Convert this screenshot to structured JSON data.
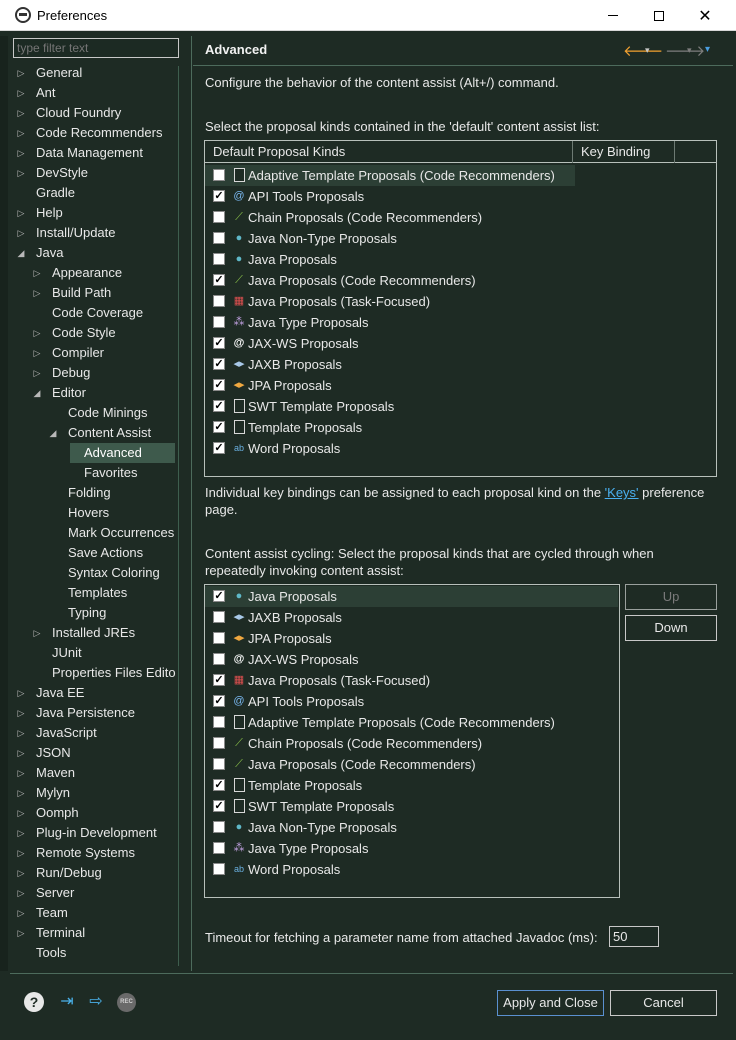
{
  "window": {
    "title": "Preferences",
    "minimize": "—",
    "maximize": "☐",
    "close": "✕"
  },
  "filter": {
    "placeholder": "type filter text"
  },
  "tree": [
    {
      "label": "General",
      "depth": 0,
      "arrow": "▷"
    },
    {
      "label": "Ant",
      "depth": 0,
      "arrow": "▷"
    },
    {
      "label": "Cloud Foundry",
      "depth": 0,
      "arrow": "▷"
    },
    {
      "label": "Code Recommenders",
      "depth": 0,
      "arrow": "▷"
    },
    {
      "label": "Data Management",
      "depth": 0,
      "arrow": "▷"
    },
    {
      "label": "DevStyle",
      "depth": 0,
      "arrow": "▷"
    },
    {
      "label": "Gradle",
      "depth": 0,
      "arrow": ""
    },
    {
      "label": "Help",
      "depth": 0,
      "arrow": "▷"
    },
    {
      "label": "Install/Update",
      "depth": 0,
      "arrow": "▷"
    },
    {
      "label": "Java",
      "depth": 0,
      "arrow": "◢"
    },
    {
      "label": "Appearance",
      "depth": 1,
      "arrow": "▷"
    },
    {
      "label": "Build Path",
      "depth": 1,
      "arrow": "▷"
    },
    {
      "label": "Code Coverage",
      "depth": 1,
      "arrow": ""
    },
    {
      "label": "Code Style",
      "depth": 1,
      "arrow": "▷"
    },
    {
      "label": "Compiler",
      "depth": 1,
      "arrow": "▷"
    },
    {
      "label": "Debug",
      "depth": 1,
      "arrow": "▷"
    },
    {
      "label": "Editor",
      "depth": 1,
      "arrow": "◢"
    },
    {
      "label": "Code Minings",
      "depth": 2,
      "arrow": ""
    },
    {
      "label": "Content Assist",
      "depth": 2,
      "arrow": "◢"
    },
    {
      "label": "Advanced",
      "depth": 3,
      "arrow": "",
      "selected": true
    },
    {
      "label": "Favorites",
      "depth": 3,
      "arrow": ""
    },
    {
      "label": "Folding",
      "depth": 2,
      "arrow": ""
    },
    {
      "label": "Hovers",
      "depth": 2,
      "arrow": ""
    },
    {
      "label": "Mark Occurrences",
      "depth": 2,
      "arrow": ""
    },
    {
      "label": "Save Actions",
      "depth": 2,
      "arrow": ""
    },
    {
      "label": "Syntax Coloring",
      "depth": 2,
      "arrow": ""
    },
    {
      "label": "Templates",
      "depth": 2,
      "arrow": ""
    },
    {
      "label": "Typing",
      "depth": 2,
      "arrow": ""
    },
    {
      "label": "Installed JREs",
      "depth": 1,
      "arrow": "▷"
    },
    {
      "label": "JUnit",
      "depth": 1,
      "arrow": ""
    },
    {
      "label": "Properties Files Edito",
      "depth": 1,
      "arrow": ""
    },
    {
      "label": "Java EE",
      "depth": 0,
      "arrow": "▷"
    },
    {
      "label": "Java Persistence",
      "depth": 0,
      "arrow": "▷"
    },
    {
      "label": "JavaScript",
      "depth": 0,
      "arrow": "▷"
    },
    {
      "label": "JSON",
      "depth": 0,
      "arrow": "▷"
    },
    {
      "label": "Maven",
      "depth": 0,
      "arrow": "▷"
    },
    {
      "label": "Mylyn",
      "depth": 0,
      "arrow": "▷"
    },
    {
      "label": "Oomph",
      "depth": 0,
      "arrow": "▷"
    },
    {
      "label": "Plug-in Development",
      "depth": 0,
      "arrow": "▷"
    },
    {
      "label": "Remote Systems",
      "depth": 0,
      "arrow": "▷"
    },
    {
      "label": "Run/Debug",
      "depth": 0,
      "arrow": "▷"
    },
    {
      "label": "Server",
      "depth": 0,
      "arrow": "▷"
    },
    {
      "label": "Team",
      "depth": 0,
      "arrow": "▷"
    },
    {
      "label": "Terminal",
      "depth": 0,
      "arrow": "▷"
    },
    {
      "label": "Tools",
      "depth": 0,
      "arrow": ""
    }
  ],
  "page": {
    "title": "Advanced",
    "nav": {
      "back": "🡐",
      "dropdown": "▾",
      "forward": "🡒",
      "menu": "▾"
    },
    "description": "Configure the behavior of the content assist (Alt+/) command.",
    "default_list_label": "Select the proposal kinds contained in the 'default' content assist list:",
    "default_table": {
      "col_kinds": "Default Proposal Kinds",
      "col_binding": "Key Binding",
      "rows": [
        {
          "checked": false,
          "icon": "doc",
          "name": "Adaptive Template Proposals (Code Recommenders)"
        },
        {
          "checked": true,
          "icon": "blue",
          "name": "API Tools Proposals"
        },
        {
          "checked": false,
          "icon": "green",
          "name": "Chain Proposals (Code Recommenders)"
        },
        {
          "checked": false,
          "icon": "java",
          "name": "Java Non-Type Proposals"
        },
        {
          "checked": false,
          "icon": "java",
          "name": "Java Proposals"
        },
        {
          "checked": true,
          "icon": "green",
          "name": "Java Proposals (Code Recommenders)"
        },
        {
          "checked": false,
          "icon": "task",
          "name": "Java Proposals (Task-Focused)"
        },
        {
          "checked": false,
          "icon": "type",
          "name": "Java Type Proposals"
        },
        {
          "checked": true,
          "icon": "at",
          "name": "JAX-WS Proposals"
        },
        {
          "checked": true,
          "icon": "jaxb",
          "name": "JAXB Proposals"
        },
        {
          "checked": true,
          "icon": "jpa",
          "name": "JPA Proposals"
        },
        {
          "checked": true,
          "icon": "doc",
          "name": "SWT Template Proposals"
        },
        {
          "checked": true,
          "icon": "doc",
          "name": "Template Proposals"
        },
        {
          "checked": true,
          "icon": "word",
          "name": "Word Proposals"
        }
      ]
    },
    "keybind_note_pre": "Individual key bindings can be assigned to each proposal kind on the ",
    "keybind_link": "'Keys'",
    "keybind_note_post": " preference",
    "keybind_note_line2": "page.",
    "cycling_label_1": "Content assist cycling: Select the proposal kinds that are cycled through when",
    "cycling_label_2": "repeatedly invoking content assist:",
    "cycling_table": {
      "rows": [
        {
          "checked": true,
          "icon": "java",
          "name": "Java Proposals"
        },
        {
          "checked": false,
          "icon": "jaxb",
          "name": "JAXB Proposals"
        },
        {
          "checked": false,
          "icon": "jpa",
          "name": "JPA Proposals"
        },
        {
          "checked": false,
          "icon": "at",
          "name": "JAX-WS Proposals"
        },
        {
          "checked": true,
          "icon": "task",
          "name": "Java Proposals (Task-Focused)"
        },
        {
          "checked": true,
          "icon": "blue",
          "name": "API Tools Proposals"
        },
        {
          "checked": false,
          "icon": "doc",
          "name": "Adaptive Template Proposals (Code Recommenders)"
        },
        {
          "checked": false,
          "icon": "green",
          "name": "Chain Proposals (Code Recommenders)"
        },
        {
          "checked": false,
          "icon": "green",
          "name": "Java Proposals (Code Recommenders)"
        },
        {
          "checked": true,
          "icon": "doc",
          "name": "Template Proposals"
        },
        {
          "checked": true,
          "icon": "doc",
          "name": "SWT Template Proposals"
        },
        {
          "checked": false,
          "icon": "java",
          "name": "Java Non-Type Proposals"
        },
        {
          "checked": false,
          "icon": "type",
          "name": "Java Type Proposals"
        },
        {
          "checked": false,
          "icon": "word",
          "name": "Word Proposals"
        }
      ]
    },
    "up_button": "Up",
    "down_button": "Down",
    "timeout_label": "Timeout for fetching a parameter name from attached Javadoc (ms):",
    "timeout_value": "50"
  },
  "footer": {
    "help_icon": "?",
    "rec_icon": "REC",
    "apply_close": "Apply and Close",
    "cancel": "Cancel"
  },
  "colors": {
    "background": "#1e2b24",
    "selection": "#3e5a4c",
    "link": "#4ab0f0"
  }
}
